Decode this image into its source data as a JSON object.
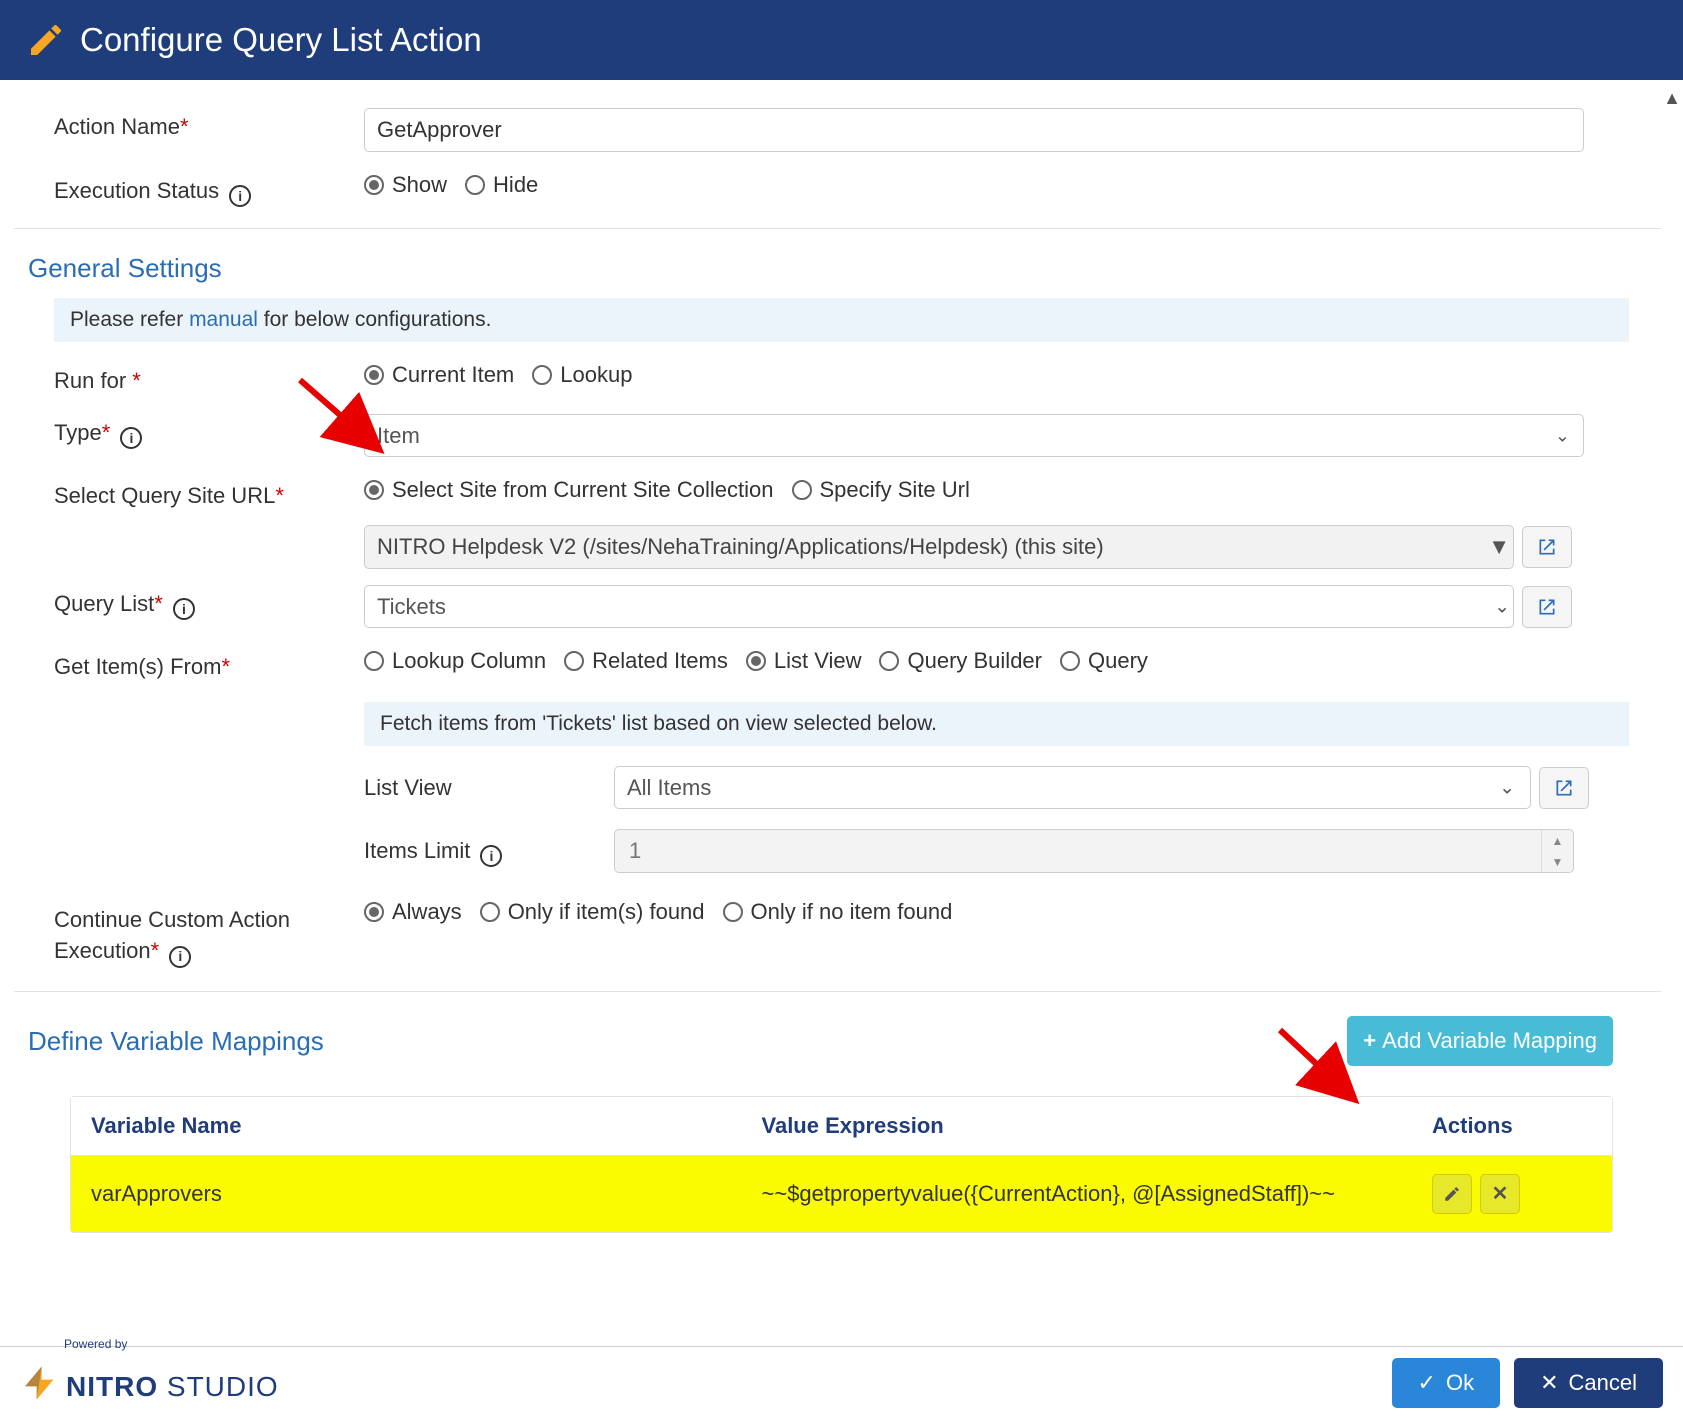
{
  "header": {
    "title": "Configure Query List Action"
  },
  "actionName": {
    "label": "Action Name",
    "value": "GetApprover"
  },
  "executionStatus": {
    "label": "Execution Status",
    "options": {
      "show": "Show",
      "hide": "Hide"
    },
    "selected": "show"
  },
  "generalSettings": {
    "title": "General Settings",
    "banner_pre": "Please refer ",
    "banner_link": "manual",
    "banner_post": " for below configurations."
  },
  "runFor": {
    "label": "Run for",
    "options": {
      "current": "Current Item",
      "lookup": "Lookup"
    },
    "selected": "current"
  },
  "type": {
    "label": "Type",
    "value": "Item"
  },
  "siteUrl": {
    "label": "Select Query Site URL",
    "options": {
      "collection": "Select Site from Current Site Collection",
      "specify": "Specify Site Url"
    },
    "selected": "collection",
    "siteValue": "NITRO Helpdesk V2 (/sites/NehaTraining/Applications/Helpdesk) (this site)"
  },
  "queryList": {
    "label": "Query List",
    "value": "Tickets"
  },
  "getItemsFrom": {
    "label": "Get Item(s) From",
    "options": {
      "lookup": "Lookup Column",
      "related": "Related Items",
      "listview": "List View",
      "querybuilder": "Query Builder",
      "query": "Query"
    },
    "selected": "listview",
    "banner": "Fetch items from 'Tickets' list based on view selected below."
  },
  "listView": {
    "label": "List View",
    "value": "All Items"
  },
  "itemsLimit": {
    "label": "Items Limit",
    "value": "1"
  },
  "continueExec": {
    "label": "Continue Custom Action Execution",
    "options": {
      "always": "Always",
      "found": "Only if item(s) found",
      "notfound": "Only if no item found"
    },
    "selected": "always"
  },
  "mappings": {
    "title": "Define Variable Mappings",
    "addLabel": "Add Variable Mapping",
    "headers": {
      "name": "Variable Name",
      "expr": "Value Expression",
      "actions": "Actions"
    },
    "rows": [
      {
        "name": "varApprovers",
        "expr": "~~$getpropertyvalue({CurrentAction}, @[AssignedStaff])~~"
      }
    ]
  },
  "footer": {
    "poweredBy": "Powered by",
    "brandBold": "NITRO",
    "brandLight": "STUDIO",
    "ok": "Ok",
    "cancel": "Cancel"
  }
}
